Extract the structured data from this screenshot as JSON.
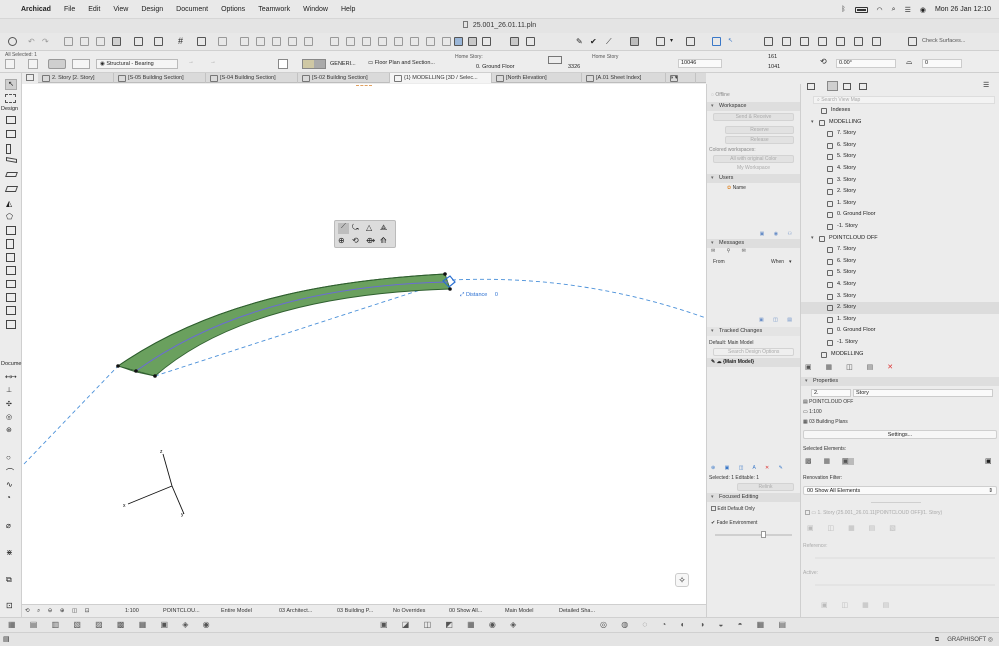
{
  "menubar": {
    "app": "Archicad",
    "items": [
      "File",
      "Edit",
      "View",
      "Design",
      "Document",
      "Options",
      "Teamwork",
      "Window",
      "Help"
    ],
    "clock": "Mon 26 Jan  12:10"
  },
  "window": {
    "title": "25.001_26.01.11.pln"
  },
  "toolbar": {
    "check_surfaces": "Check Surfaces..."
  },
  "infobox": {
    "all_selected": "All Selected: 1",
    "structure": "Structural - Bearing",
    "composite": "GENERI...",
    "floor_plan": "Floor Plan and Section...",
    "home_story_label": "Home Story:",
    "home_story_value": "0. Ground Floor",
    "home_story_short": "Home Story",
    "height": "3326",
    "offset": "10046",
    "thk1": "161",
    "thk2": "1041",
    "angle": "0.00°",
    "val0": "0"
  },
  "tabs": [
    "2. Story [2. Story]",
    "[S-05 Building Section]",
    "[S-04 Building Section]",
    "[S-02 Building Section]",
    "{1} MODELLING [3D / Selec...",
    "[North Elevation]",
    "[A.01 Sheet Index]"
  ],
  "toolbox": {
    "design_label": "Design",
    "document_label": "Docume"
  },
  "canvas": {
    "distance_label": "Distance",
    "distance_value": "0",
    "axis_x": "x",
    "axis_y": "y",
    "axis_z": "z"
  },
  "teamwork": {
    "offline": "Offline",
    "workspace_header": "Workspace",
    "send_receive": "Send & Receive",
    "reserve": "Reserve",
    "release": "Release",
    "colored_workspaces": "Colored workspaces:",
    "all_original_color": "All with original Color",
    "my_workspace": "My Workspace",
    "users_header": "Users",
    "user_name": "Name",
    "messages_header": "Messages",
    "from_col": "From",
    "when_col": "When",
    "tracked_changes": "Tracked Changes",
    "default_main_model": "Default: Main Model",
    "search_design_options": "Search Design Options",
    "main_model": "{Main Model}",
    "selected_editable": "Selected: 1 Editable: 1",
    "relink": "Relink",
    "focused_editing": "Focused Editing",
    "edit_default_only": "Edit Default Only",
    "fade_environment": "Fade Environment"
  },
  "navigator": {
    "search_placeholder": "Search View Map",
    "rows": [
      {
        "label": "Indexes",
        "level": 1,
        "type": "folder"
      },
      {
        "label": "MODELLING",
        "level": 0,
        "type": "set"
      },
      {
        "label": "7. Story",
        "level": 2,
        "type": "view"
      },
      {
        "label": "6. Story",
        "level": 2,
        "type": "view"
      },
      {
        "label": "5. Story",
        "level": 2,
        "type": "view"
      },
      {
        "label": "4. Story",
        "level": 2,
        "type": "view"
      },
      {
        "label": "3. Story",
        "level": 2,
        "type": "view"
      },
      {
        "label": "2. Story",
        "level": 2,
        "type": "view"
      },
      {
        "label": "1. Story",
        "level": 2,
        "type": "view"
      },
      {
        "label": "0. Ground Floor",
        "level": 2,
        "type": "view"
      },
      {
        "label": "-1. Story",
        "level": 2,
        "type": "view"
      },
      {
        "label": "POINTCLOUD OFF",
        "level": 0,
        "type": "set"
      },
      {
        "label": "7. Story",
        "level": 2,
        "type": "view"
      },
      {
        "label": "6. Story",
        "level": 2,
        "type": "view"
      },
      {
        "label": "5. Story",
        "level": 2,
        "type": "view"
      },
      {
        "label": "4. Story",
        "level": 2,
        "type": "view"
      },
      {
        "label": "3. Story",
        "level": 2,
        "type": "view"
      },
      {
        "label": "2. Story",
        "level": 2,
        "type": "view",
        "selected": true
      },
      {
        "label": "1. Story",
        "level": 2,
        "type": "view"
      },
      {
        "label": "0. Ground Floor",
        "level": 2,
        "type": "view"
      },
      {
        "label": "-1. Story",
        "level": 2,
        "type": "view"
      },
      {
        "label": "MODELLING",
        "level": 1,
        "type": "folder"
      }
    ]
  },
  "properties": {
    "header": "Properties",
    "id_value": "2.",
    "name_value": "Story",
    "layer_combo": "POINTCLOUD OFF",
    "scale": "1:100",
    "model_view": "03 Building Plans",
    "settings_button": "Settings...",
    "selected_elements": "Selected Elements:",
    "renovation_filter": "Renovation Filter:",
    "renovation_value": "00 Show All Elements",
    "story_ref": "1. Story (25.001_26.01.11[POINTCLOUD OFF]/1. Story)",
    "reference_label": "Reference:",
    "active_label": "Active:"
  },
  "quick_options": {
    "scale": "1:100",
    "layer": "POINTCLOU...",
    "model": "Entire Model",
    "mvo": "03 Architect...",
    "pen_set": "03 Building P...",
    "override": "No Overrides",
    "renovation": "00 Show All...",
    "main_model": "Main Model",
    "detail": "Detailed Sha..."
  },
  "status": {
    "brand": "GRAPHISOFT"
  },
  "colors": {
    "beam_fill": "#6aa05e",
    "beam_stroke": "#2f5f2f",
    "guide_blue": "#4a90d9",
    "axis_line": "#6b6bd6"
  }
}
